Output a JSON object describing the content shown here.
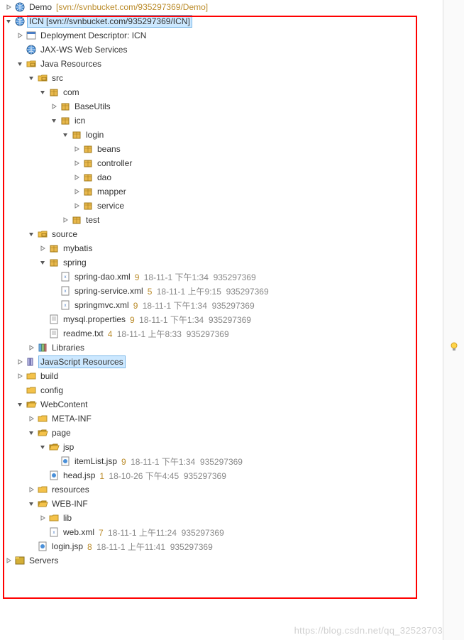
{
  "projects": {
    "demo": {
      "name": "Demo",
      "repo": "[svn://svnbucket.com/935297369/Demo]"
    },
    "icn": {
      "name": "ICN",
      "repo": "[svn://svnbucket.com/935297369/ICN]"
    },
    "servers": {
      "name": "Servers"
    }
  },
  "icn_children": {
    "deploy": "Deployment Descriptor: ICN",
    "jax": "JAX-WS Web Services",
    "java": "Java Resources",
    "jslib": "JavaScript Resources",
    "build": "build",
    "config": "config",
    "web": "WebContent"
  },
  "java_src": {
    "src": "src",
    "com": "com",
    "baseutils": "BaseUtils",
    "icn": "icn",
    "login": "login",
    "beans": "beans",
    "controller": "controller",
    "dao": "dao",
    "mapper": "mapper",
    "service": "service",
    "test": "test",
    "source": "source",
    "mybatis": "mybatis",
    "spring": "spring",
    "libraries": "Libraries"
  },
  "files": {
    "spring_dao": {
      "name": "spring-dao.xml",
      "rev": "9",
      "date": "18-11-1 下午1:34",
      "author": "935297369"
    },
    "spring_service": {
      "name": "spring-service.xml",
      "rev": "5",
      "date": "18-11-1 上午9:15",
      "author": "935297369"
    },
    "springmvc": {
      "name": "springmvc.xml",
      "rev": "9",
      "date": "18-11-1 下午1:34",
      "author": "935297369"
    },
    "mysql": {
      "name": "mysql.properties",
      "rev": "9",
      "date": "18-11-1 下午1:34",
      "author": "935297369"
    },
    "readme": {
      "name": "readme.txt",
      "rev": "4",
      "date": "18-11-1 上午8:33",
      "author": "935297369"
    },
    "itemlist": {
      "name": "itemList.jsp",
      "rev": "9",
      "date": "18-11-1 下午1:34",
      "author": "935297369"
    },
    "head": {
      "name": "head.jsp",
      "rev": "1",
      "date": "18-10-26 下午4:45",
      "author": "935297369"
    },
    "webxml": {
      "name": "web.xml",
      "rev": "7",
      "date": "18-11-1 上午11:24",
      "author": "935297369"
    },
    "loginjsp": {
      "name": "login.jsp",
      "rev": "8",
      "date": "18-11-1 上午11:41",
      "author": "935297369"
    }
  },
  "webcontent": {
    "meta": "META-INF",
    "page": "page",
    "jsp": "jsp",
    "resources": "resources",
    "webinf": "WEB-INF",
    "lib": "lib"
  },
  "watermark": "https://blog.csdn.net/qq_32523703"
}
